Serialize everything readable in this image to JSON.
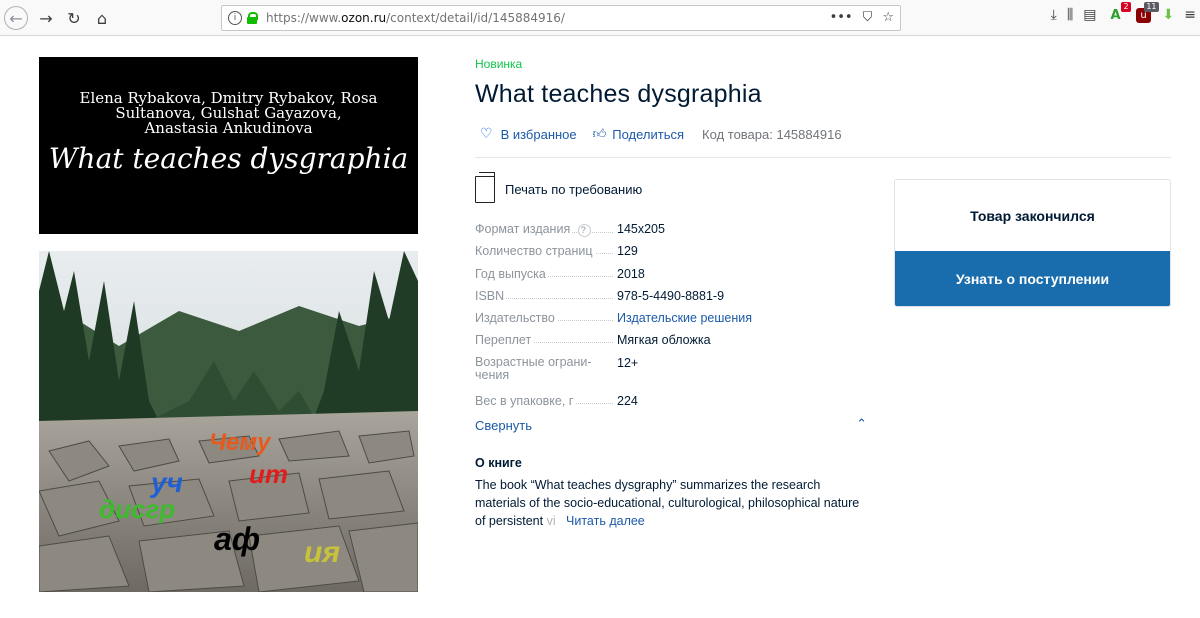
{
  "browser": {
    "url_prefix": "https://www.",
    "url_domain": "ozon.ru",
    "url_path": "/context/detail/id/145884916/",
    "icons": [
      "back-arrow",
      "forward-arrow",
      "reload",
      "home",
      "info",
      "lock",
      "more",
      "pocket",
      "bookmark-star",
      "download",
      "library",
      "sidebar",
      "extension-a",
      "extension-u",
      "extension-download",
      "menu"
    ],
    "ext_badges": [
      "2",
      "11"
    ],
    "more_label": "•••"
  },
  "cover": {
    "authors": "Elena Rybakova, Dmitry Rybakov, Rosa Sultanova, Gulshat Gayazova, Anastasia Ankudinova",
    "title": "What teaches dysgraphia",
    "words": [
      "Чему",
      "ит",
      "уч",
      "дисгр",
      "аф",
      "ия"
    ]
  },
  "product": {
    "badge": "Новинка",
    "title": "What teaches dysgraphia",
    "favorite_label": "В избранное",
    "share_label": "Поделиться",
    "code_label": "Код товара: 145884916",
    "print_label": "Печать по требованию"
  },
  "specs": [
    {
      "key": "Формат издания",
      "value": "145x205",
      "help": "?"
    },
    {
      "key": "Количество страниц",
      "value": "129"
    },
    {
      "key": "Год выпуска",
      "value": "2018"
    },
    {
      "key": "ISBN",
      "value": "978-5-4490-8881-9"
    },
    {
      "key": "Издательство",
      "value": "Издательские решения",
      "link": true
    },
    {
      "key": "Переплет",
      "value": "Мягкая обложка"
    },
    {
      "key": "Возрастные ограни-чения",
      "value": "12+"
    },
    {
      "key": "Вес в упаковке, г",
      "value": "224"
    }
  ],
  "collapse_label": "Свернуть",
  "about": {
    "heading": "О книге",
    "text": "The book “What teaches dysgraphy” summarizes the research materials of the socio-educational, culturological, philosophical nature of persistent ",
    "fade": "vi",
    "more": "Читать далее"
  },
  "buybox": {
    "status": "Товар закончился",
    "notify": "Узнать о поступлении"
  }
}
